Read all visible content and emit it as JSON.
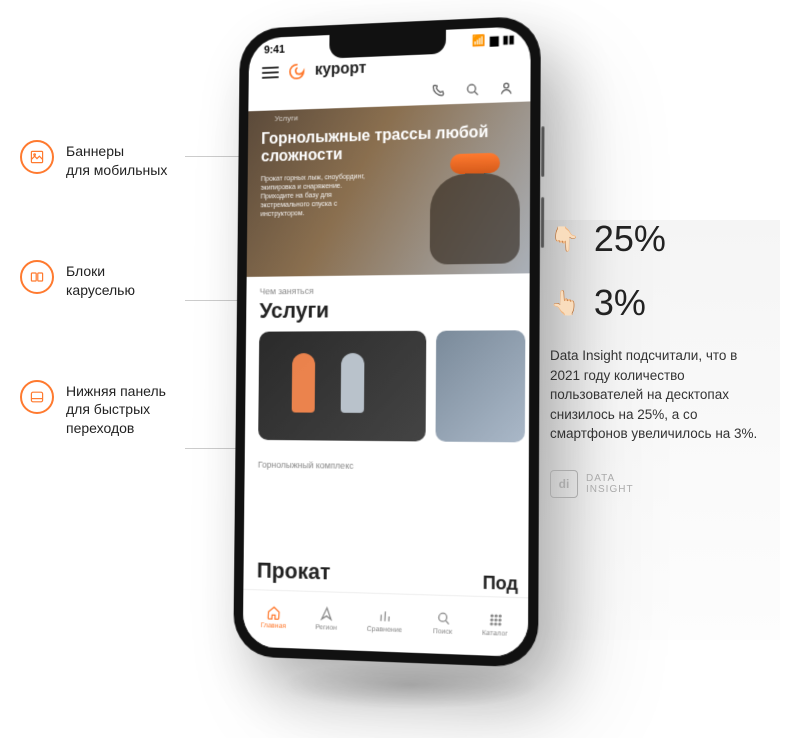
{
  "callouts": [
    {
      "label": "Баннеры\nдля мобильных"
    },
    {
      "label": "Блоки\nкаруселью"
    },
    {
      "label": "Нижняя панель\nдля быстрых\nпереходов"
    }
  ],
  "phone": {
    "status": {
      "time": "9:41"
    },
    "app_title": "курорт",
    "breadcrumb": "Услуги",
    "hero": {
      "title": "Горнолыжные трассы любой сложности",
      "desc": "Прокат горных лыж, сноубординг, экипировка и снаряжение. Приходите на базу для экстремального спуска с инструктором."
    },
    "section1": {
      "eyebrow": "Чем заняться",
      "title": "Услуги"
    },
    "section2": {
      "eyebrow": "Горнолыжный комплекс",
      "title": "Прокат",
      "right": "Под"
    },
    "nav": [
      {
        "label": "Главная"
      },
      {
        "label": "Регион"
      },
      {
        "label": "Сравнение"
      },
      {
        "label": "Поиск"
      },
      {
        "label": "Каталог"
      }
    ]
  },
  "stats": {
    "down": {
      "emoji": "👇🏻",
      "value": "25%"
    },
    "up": {
      "emoji": "👆🏻",
      "value": "3%"
    },
    "desc": "Data Insight подсчитали, что в 2021 году количество пользователей на десктопах снизилось на 25%, а со смартфонов увеличилось на 3%.",
    "logo_mark": "di",
    "logo_text_1": "DATA",
    "logo_text_2": "INSIGHT"
  }
}
